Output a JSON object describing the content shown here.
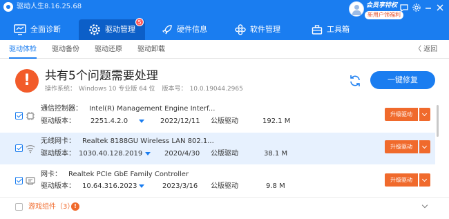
{
  "app": {
    "title": "驱动人生8.16.25.68"
  },
  "account": {
    "vip_title": "会员享特权",
    "vip_badge": "新用户领福利"
  },
  "window_icons": [
    "chat-icon",
    "gear-icon",
    "minimize-icon",
    "close-icon"
  ],
  "nav": {
    "tabs": [
      {
        "label": "全面诊断",
        "icon": "monitor-icon"
      },
      {
        "label": "驱动管理",
        "icon": "gear-icon",
        "badge": "5",
        "active": true
      },
      {
        "label": "硬件信息",
        "icon": "rocket-icon"
      },
      {
        "label": "软件管理",
        "icon": "apps-icon"
      },
      {
        "label": "工具箱",
        "icon": "toolbox-icon"
      }
    ]
  },
  "subnav": {
    "tabs": [
      "驱动体检",
      "驱动备份",
      "驱动还原",
      "驱动卸载"
    ],
    "active": "驱动体检",
    "back_label": "〈 返回"
  },
  "summary": {
    "title": "共有5个问题需要处理",
    "os_label": "操作系统：",
    "os_value": "Windows 10 专业版 64 位",
    "ver_label": "版本号：",
    "ver_value": "10.0.19044.2965",
    "fix_button": "一键修复"
  },
  "drivers": [
    {
      "category": "通信控制器：",
      "device": "Intel(R) Management Engine Interf...",
      "version_label": "驱动版本：",
      "version": "2251.4.2.0",
      "date": "2022/12/11",
      "vendor": "公版驱动",
      "size": "192.1 M",
      "action": "升级驱动",
      "icon": "chip-icon",
      "checked": true,
      "highlighted": false
    },
    {
      "category": "无线网卡：",
      "device": "Realtek 8188GU Wireless LAN 802.1...",
      "version_label": "驱动版本：",
      "version": "1030.40.128.2019",
      "date": "2020/4/30",
      "vendor": "公版驱动",
      "size": "38.1 M",
      "action": "升级驱动",
      "icon": "wifi-icon",
      "checked": true,
      "highlighted": true
    },
    {
      "category": "网卡：",
      "device": "Realtek PCIe GbE Family Controller",
      "version_label": "驱动版本：",
      "version": "10.64.316.2023",
      "date": "2023/3/16",
      "vendor": "公版驱动",
      "size": "9.8 M",
      "action": "升级驱动",
      "icon": "network-card-icon",
      "checked": true,
      "highlighted": false
    }
  ],
  "games": {
    "label": "游戏组件（3）",
    "info": "!"
  },
  "colors": {
    "brand": "#1a7df0",
    "action": "#f06a2c",
    "warning": "#f25b2a"
  }
}
